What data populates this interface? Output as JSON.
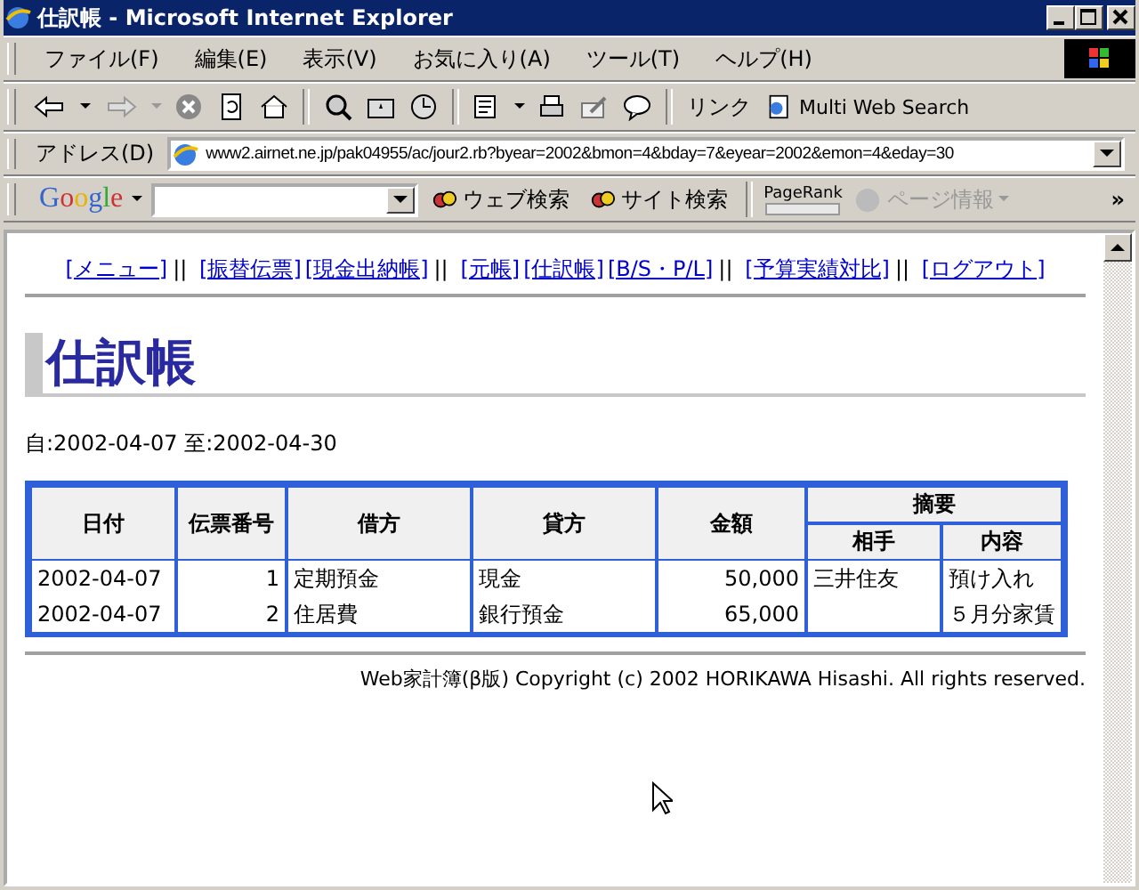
{
  "window": {
    "title": "仕訳帳 - Microsoft Internet Explorer"
  },
  "menu": [
    "ファイル(F)",
    "編集(E)",
    "表示(V)",
    "お気に入り(A)",
    "ツール(T)",
    "ヘルプ(H)"
  ],
  "links_bar": {
    "label": "リンク",
    "items": [
      "Multi Web Search"
    ]
  },
  "address": {
    "label": "アドレス(D)",
    "value": "www2.airnet.ne.jp/pak04955/ac/jour2.rb?byear=2002&bmon=4&bday=7&eyear=2002&emon=4&eday=30"
  },
  "google_bar": {
    "logo": "Google",
    "buttons": [
      {
        "label": "ウェブ検索",
        "disabled": false
      },
      {
        "label": "サイト検索",
        "disabled": false
      },
      {
        "label": "ページ情報",
        "disabled": true
      }
    ],
    "pagerank_label": "PageRank",
    "more": "»"
  },
  "nav": {
    "separator": "||",
    "groups": [
      [
        "[メニュー]"
      ],
      [
        "[振替伝票]",
        "[現金出納帳]"
      ],
      [
        "[元帳]",
        "[仕訳帳]",
        "[B/S・P/L]"
      ],
      [
        "[予算実績対比]"
      ],
      [
        "[ログアウト]"
      ]
    ]
  },
  "heading": "仕訳帳",
  "period": "自:2002-04-07 至:2002-04-30",
  "table": {
    "columns": [
      "日付",
      "伝票番号",
      "借方",
      "貸方",
      "金額"
    ],
    "group_header": "摘要",
    "sub_columns": [
      "相手",
      "内容"
    ],
    "rows": [
      {
        "date": "2002-04-07",
        "slip_no": "1",
        "debit": "定期預金",
        "credit": "現金",
        "amount": "50,000",
        "partner": "三井住友",
        "memo": "預け入れ"
      },
      {
        "date": "2002-04-07",
        "slip_no": "2",
        "debit": "住居費",
        "credit": "銀行預金",
        "amount": "65,000",
        "memo": "５月分家賃"
      }
    ]
  },
  "footer": "Web家計簿(β版) Copyright (c) 2002 HORIKAWA Hisashi. All rights reserved."
}
